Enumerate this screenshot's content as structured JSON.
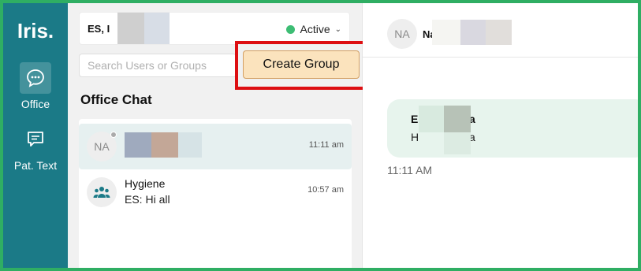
{
  "app": {
    "logo": "Iris."
  },
  "rail": {
    "items": [
      {
        "label": "Office",
        "icon": "chat-bubble-icon",
        "active": true
      },
      {
        "label": "Pat. Text",
        "icon": "message-icon",
        "active": false
      }
    ]
  },
  "user": {
    "name": "ES, I",
    "status_label": "Active",
    "status_color": "#3dbd74"
  },
  "search": {
    "placeholder": "Search Users or Groups",
    "value": ""
  },
  "create_group": {
    "label": "Create Group"
  },
  "section": {
    "title": "Office Chat"
  },
  "chats": [
    {
      "avatar": "NA",
      "title": "N",
      "preview": "",
      "time": "11:11 am",
      "selected": true
    },
    {
      "avatar": "group-icon",
      "title": "Hygiene",
      "preview": "ES: Hi all",
      "time": "10:57 am",
      "selected": false
    }
  ],
  "conversation": {
    "avatar": "NA",
    "name": "Na",
    "message": {
      "sender": "E",
      "sender_tail": "a",
      "text": "H",
      "text_tail": "a",
      "time": "11:11 AM"
    }
  },
  "colors": {
    "rail": "#1b7a87",
    "accent": "#fbe3bd",
    "highlight": "#dd0f12",
    "frame": "#2fae63"
  }
}
